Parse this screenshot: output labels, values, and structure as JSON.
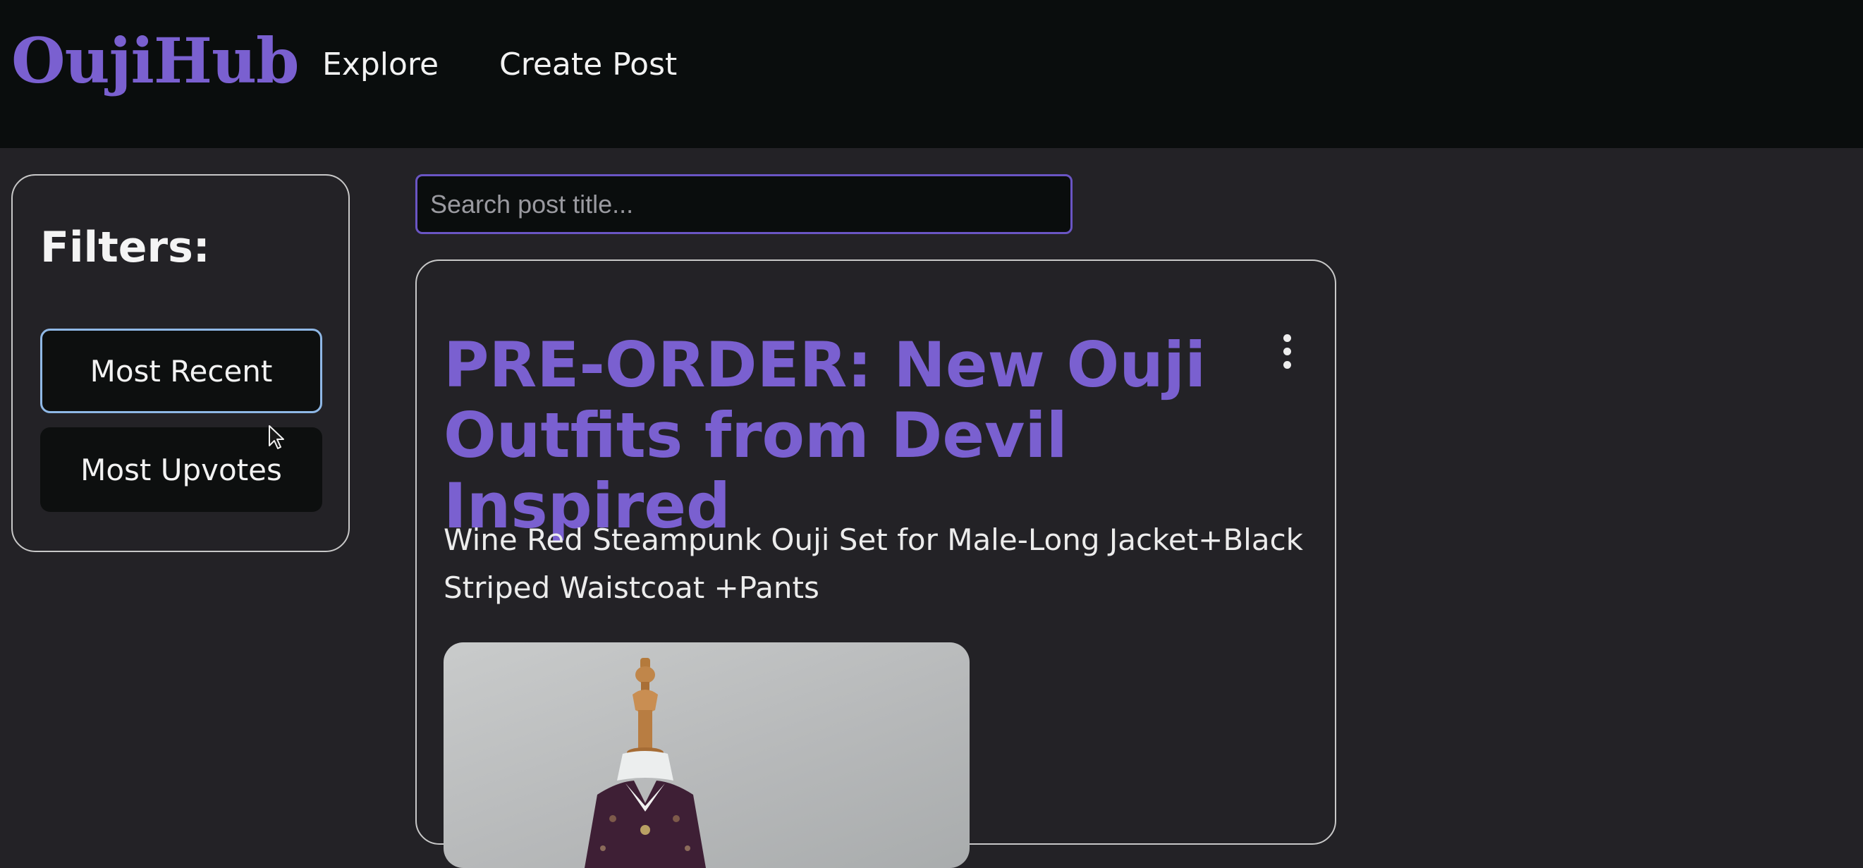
{
  "header": {
    "logo": "OujiHub",
    "nav": [
      {
        "label": "Explore"
      },
      {
        "label": "Create Post"
      }
    ]
  },
  "filters": {
    "title": "Filters:",
    "options": [
      {
        "label": "Most Recent",
        "selected": true
      },
      {
        "label": "Most Upvotes",
        "selected": false
      }
    ]
  },
  "search": {
    "placeholder": "Search post title...",
    "value": ""
  },
  "post": {
    "title": "PRE-ORDER: New Ouji Outfits from Devil Inspired",
    "description": "Wine Red Steampunk Ouji Set for Male-Long Jacket+Black Striped Waistcoat +Pants",
    "menu_icon": "more-vertical-icon",
    "image_icon": "mannequin-outfit-photo"
  },
  "colors": {
    "accent": "#7a60d0",
    "header_bg": "#0a0d0d",
    "page_bg": "#232226",
    "selected_border": "#8fb8e6",
    "search_border": "#6a55c4"
  }
}
